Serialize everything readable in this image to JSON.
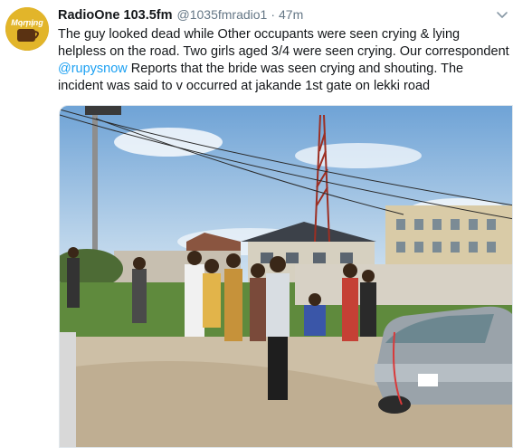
{
  "account": {
    "display_name": "RadioOne 103.5fm",
    "handle": "@1035fmradio1",
    "separator": "·",
    "time": "47m",
    "avatar_text": "Morning"
  },
  "tweet": {
    "text_part1": "The guy looked dead while Other occupants were seen crying & lying helpless on the road. Two girls aged 3/4 were seen crying. Our correspondent ",
    "mention": "@rupysnow",
    "text_part2": " Reports that the bride was seen crying and shouting. The incident was said to v occurred at jakande 1st gate on lekki road"
  },
  "media": {
    "icon": "photo"
  },
  "colors": {
    "link": "#1da1f2",
    "secondary_text": "#657786",
    "primary_text": "#14171a"
  }
}
